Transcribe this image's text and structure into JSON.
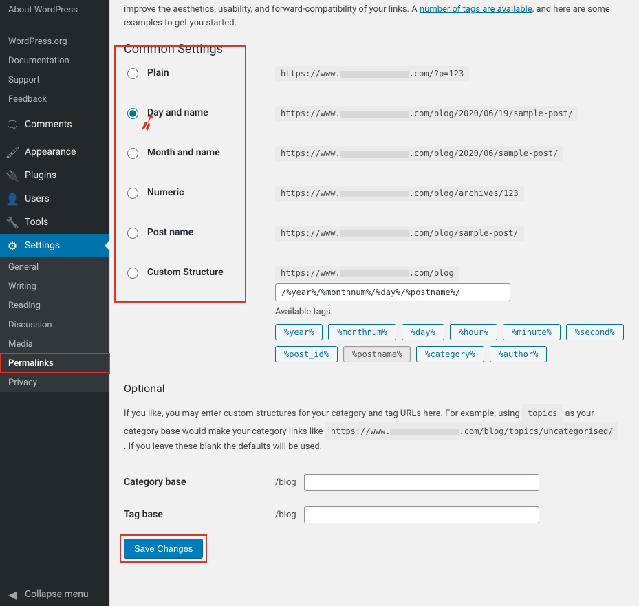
{
  "sidebar": {
    "about_items": [
      "About WordPress",
      "",
      "WordPress.org",
      "Documentation",
      "Support",
      "Feedback"
    ],
    "main_items": [
      {
        "icon": "comment",
        "label": "Comments"
      },
      {
        "icon": "appearance",
        "label": "Appearance"
      },
      {
        "icon": "plugin",
        "label": "Plugins"
      },
      {
        "icon": "user",
        "label": "Users"
      },
      {
        "icon": "tool",
        "label": "Tools"
      },
      {
        "icon": "settings",
        "label": "Settings",
        "open": true
      }
    ],
    "settings_sub": [
      "General",
      "Writing",
      "Reading",
      "Discussion",
      "Media",
      "Permalinks",
      "Privacy"
    ],
    "settings_current": "Permalinks",
    "collapse": "Collapse menu"
  },
  "intro": {
    "pre": "improve the aesthetics, usability, and forward-compatibility of your links. A ",
    "link": "number of tags are available",
    "post": ", and here are some examples to get you started."
  },
  "heading_common": "Common Settings",
  "options": [
    {
      "key": "plain",
      "label": "Plain",
      "url_pre": "https://www.",
      "url_post": ".com/?p=123",
      "redact": 100
    },
    {
      "key": "dayname",
      "label": "Day and name",
      "url_pre": "https://www.",
      "url_post": ".com/blog/2020/06/19/sample-post/",
      "redact": 100
    },
    {
      "key": "monthname",
      "label": "Month and name",
      "url_pre": "https://www.",
      "url_post": ".com/blog/2020/06/sample-post/",
      "redact": 100
    },
    {
      "key": "numeric",
      "label": "Numeric",
      "url_pre": "https://www.",
      "url_post": ".com/blog/archives/123",
      "redact": 100
    },
    {
      "key": "postname",
      "label": "Post name",
      "url_pre": "https://www.",
      "url_post": ".com/blog/sample-post/",
      "redact": 100
    },
    {
      "key": "custom",
      "label": "Custom Structure",
      "url_pre": "https://www.",
      "url_post": ".com/blog",
      "redact": 100
    }
  ],
  "selected_option": "dayname",
  "custom_value": "/%year%/%monthnum%/%day%/%postname%/",
  "available_label": "Available tags:",
  "tags": [
    "%year%",
    "%monthnum%",
    "%day%",
    "%hour%",
    "%minute%",
    "%second%",
    "%post_id%",
    "%postname%",
    "%category%",
    "%author%"
  ],
  "active_tag": "%postname%",
  "heading_optional": "Optional",
  "optional_text": {
    "a": "If you like, you may enter custom structures for your category and tag URLs here. For example, using ",
    "code1": "topics",
    "b": " as your category base would make your category links like ",
    "code2_pre": "https://www.",
    "code2_redact": 100,
    "code2_post": ".com/blog/topics/uncategorised/",
    "c": " . If you leave these blank the defaults will be used."
  },
  "category_base_label": "Category base",
  "tag_base_label": "Tag base",
  "base_prefix": "/blog",
  "category_base_value": "",
  "tag_base_value": "",
  "save_label": "Save Changes"
}
